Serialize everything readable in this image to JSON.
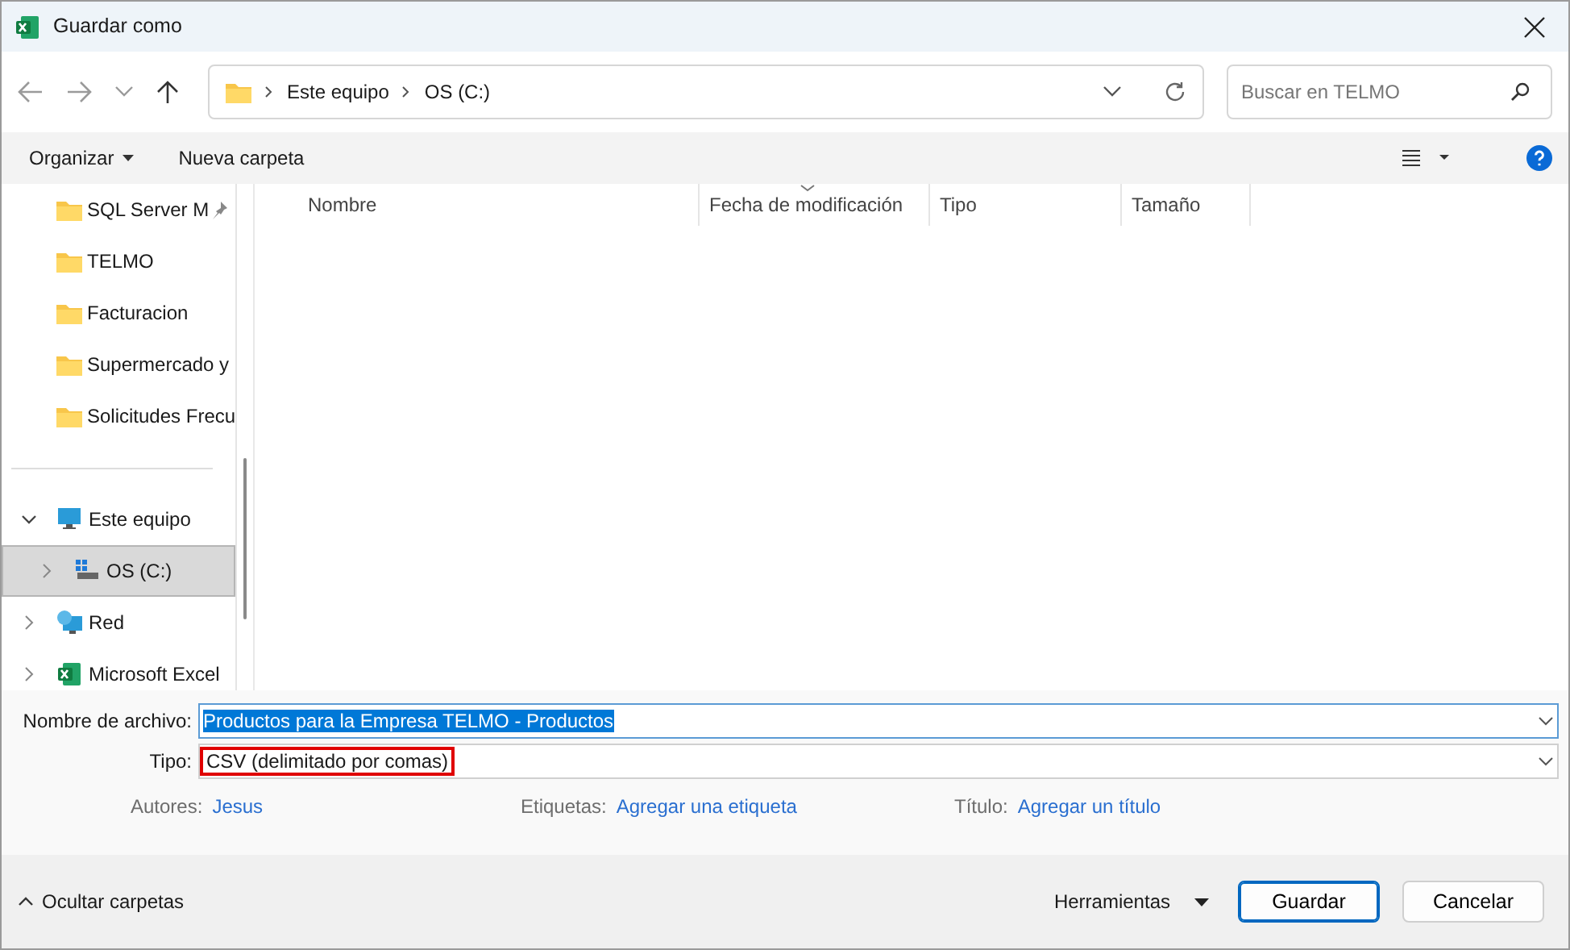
{
  "window": {
    "title": "Guardar como"
  },
  "address": {
    "breadcrumbs": [
      "Este equipo",
      "OS (C:)"
    ]
  },
  "search": {
    "placeholder": "Buscar en TELMO"
  },
  "toolbar": {
    "organize": "Organizar",
    "new_folder": "Nueva carpeta"
  },
  "quick_access": [
    {
      "label": "SQL Server M",
      "pinned": true
    },
    {
      "label": "TELMO",
      "pinned": false
    },
    {
      "label": "Facturacion",
      "pinned": false
    },
    {
      "label": "Supermercado y",
      "pinned": false
    },
    {
      "label": "Solicitudes Frecu",
      "pinned": false
    }
  ],
  "tree": [
    {
      "label": "Este equipo",
      "kind": "pc",
      "expanded": true,
      "selected": false,
      "children": [
        {
          "label": "OS (C:)",
          "kind": "drive",
          "expanded": false,
          "selected": true
        }
      ]
    },
    {
      "label": "Red",
      "kind": "network",
      "expanded": false,
      "selected": false
    },
    {
      "label": "Microsoft Excel",
      "kind": "excel",
      "expanded": false,
      "selected": false
    }
  ],
  "columns": [
    {
      "label": "Nombre",
      "sorted": false
    },
    {
      "label": "Fecha de modificación",
      "sorted": true
    },
    {
      "label": "Tipo",
      "sorted": false
    },
    {
      "label": "Tamaño",
      "sorted": false
    }
  ],
  "file_name": {
    "label": "Nombre de archivo:",
    "value": "Productos para la Empresa TELMO - Productos",
    "selected": true
  },
  "file_type": {
    "label": "Tipo:",
    "value": "CSV (delimitado por comas)",
    "highlighted": true
  },
  "metadata": [
    {
      "label": "Autores:",
      "value": "Jesus"
    },
    {
      "label": "Etiquetas:",
      "value": "Agregar una etiqueta"
    },
    {
      "label": "Título:",
      "value": "Agregar un título"
    }
  ],
  "footer": {
    "hide_folders": "Ocultar carpetas",
    "tools": "Herramientas",
    "buttons": [
      {
        "label": "Guardar",
        "primary": true
      },
      {
        "label": "Cancelar",
        "primary": false
      }
    ]
  }
}
